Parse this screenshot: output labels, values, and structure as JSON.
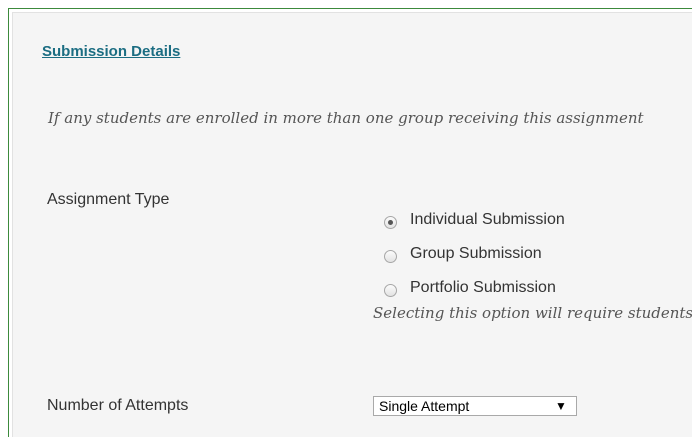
{
  "submission": {
    "title": "Submission Details",
    "note": "If any students are enrolled in more than one group receiving this assignment"
  },
  "assignment_type": {
    "label": "Assignment Type",
    "options": [
      {
        "label": "Individual Submission",
        "checked": true
      },
      {
        "label": "Group Submission",
        "checked": false
      },
      {
        "label": "Portfolio Submission",
        "checked": false
      }
    ],
    "hint": "Selecting this option will require students to submit a portfolio"
  },
  "attempts": {
    "label": "Number of Attempts",
    "selected": "Single Attempt",
    "arrow_icon": "dropdown-arrow-icon"
  }
}
